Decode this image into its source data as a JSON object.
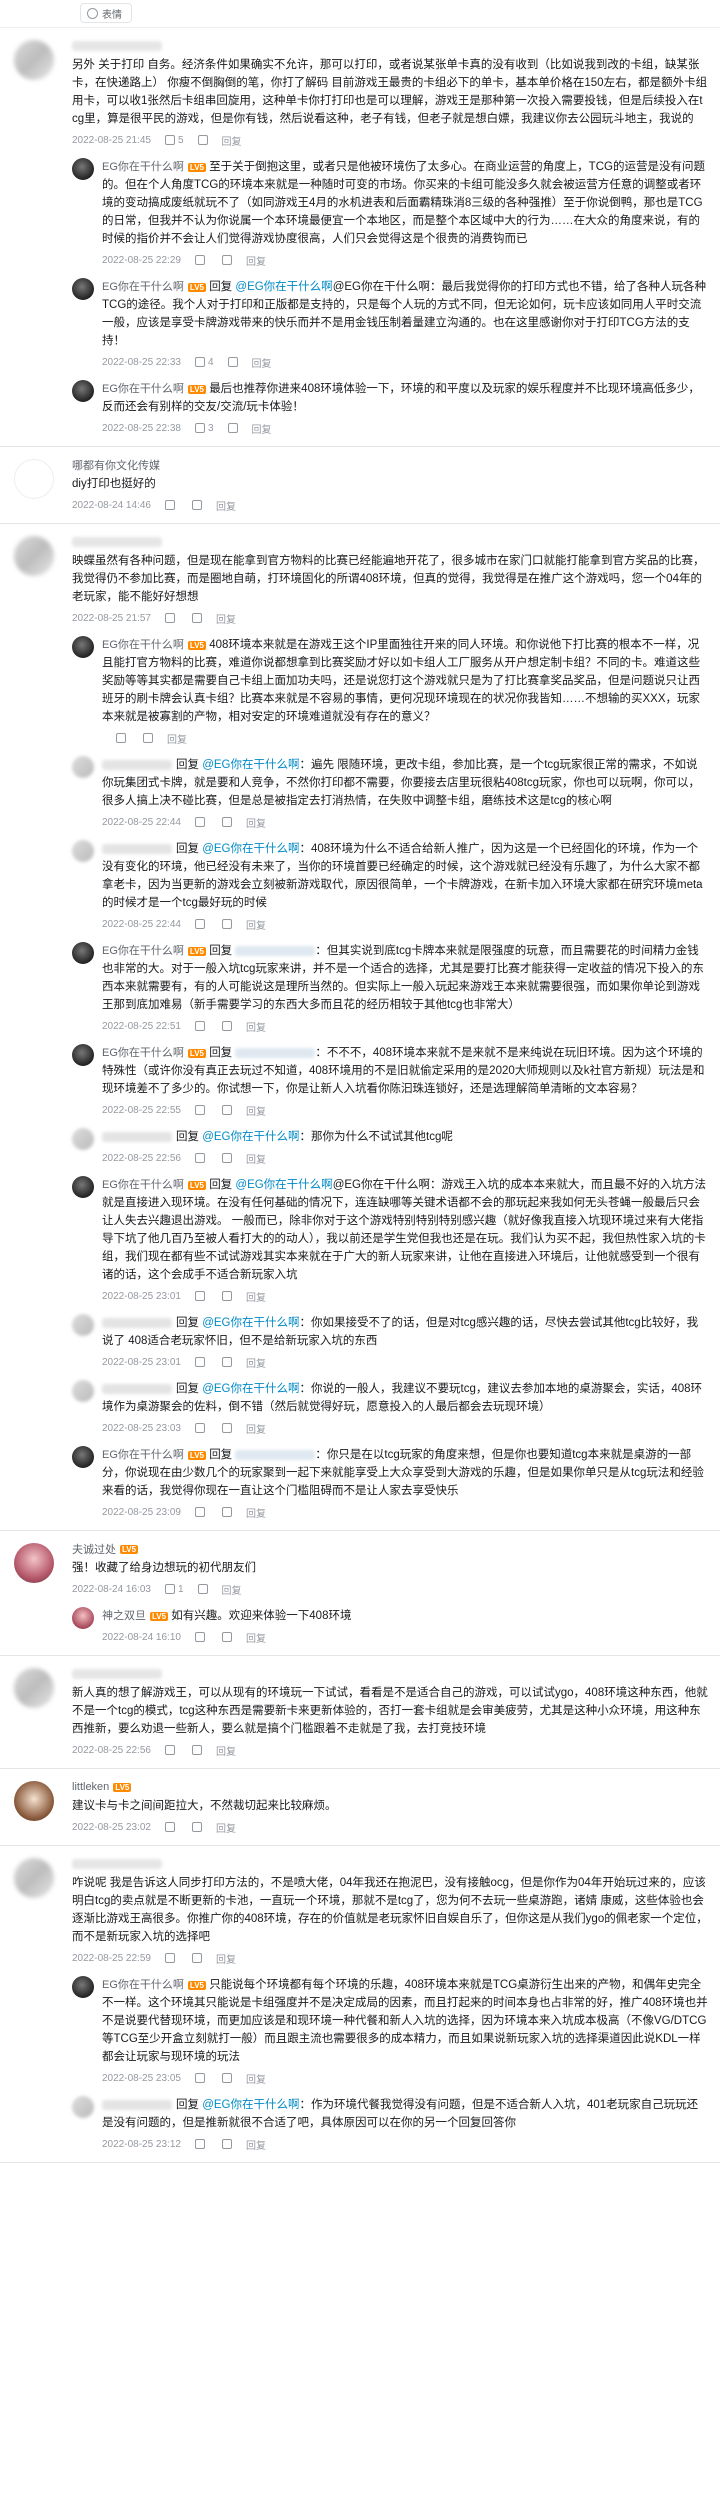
{
  "emoji_button": {
    "label": "表情",
    "icon": "smile-icon"
  },
  "reply_label": "回复",
  "comments": [
    {
      "username": "",
      "text": "另外 关于打印 自务。经济条件如果确实不允许，那可以打印，或者说某张单卡真的没有收到（比如说我到改的卡组，缺某张卡，在快递路上） 你瘦不倒胸倒的笔，你打了解码 目前游戏王最贵的卡组必下的单卡，基本单价格在150左右，都是额外卡组用卡，可以收1张然后卡组串回旋用，这种单卡你打打印也是可以理解，游戏王是那种第一次投入需要投钱，但是后续投入在tcg里，算是很平民的游戏，但是你有钱，然后说看这种，老子有钱，但老子就是想白嫖，我建议你去公园玩斗地主，我说的",
      "date": "2022-08-25 21:45",
      "likes": "5",
      "replies": [
        {
          "username": "EG你在干什么啊",
          "level": "LV5",
          "text": "至于关于倒抱这里，或者只是他被环境伤了太多心。在商业运营的角度上，TCG的运营是没有问题的。但在个人角度TCG的环境本来就是一种随时可变的市场。你买来的卡组可能没多久就会被运营方任意的调整或者环境的变动搞成废纸就玩不了（如同游戏王4月的水机进表和后面霸精珠消8三级的各种强推）至于你说倒鸭，那也是TCG的日常，但我并不认为你说属一个本环境最便宜一个本地区，而是整个本区域中大的行为……在大众的角度来说，有的时候的指价并不会让人们觉得游戏协度很高，人们只会觉得这是个很贵的消费钩而已",
          "date": "2022-08-25 22:29",
          "likes": "",
          "reply_prefix": "",
          "at": ""
        },
        {
          "username": "EG你在干什么啊",
          "level": "LV5",
          "text": "@EG你在干什么啊：最后我觉得你的打印方式也不错，给了各种人玩各种TCG的途径。我个人对于打印和正版都是支持的，只是每个人玩的方式不同，但无论如何，玩卡应该如同用人平时交流一般，应该是享受卡牌游戏带来的快乐而并不是用金钱压制着量建立沟通的。也在这里感谢你对于打印TCG方法的支持！",
          "date": "2022-08-25 22:33",
          "likes": "4",
          "reply_prefix": "回复",
          "at": "@EG你在干什么啊"
        },
        {
          "username": "EG你在干什么啊",
          "level": "LV5",
          "text": "最后也推荐你进来408环境体验一下，环境的和平度以及玩家的娱乐程度并不比现环境高低多少，反而还会有别样的交友/交流/玩卡体验！",
          "date": "2022-08-25 22:38",
          "likes": "3",
          "reply_prefix": "",
          "at": ""
        }
      ]
    },
    {
      "username": "哪都有你文化传媒",
      "text": "diy打印也挺好的",
      "date": "2022-08-24 14:46",
      "likes": "",
      "replies": []
    },
    {
      "username": "",
      "text": "映蝶虽然有各种问题，但是现在能拿到官方物料的比赛已经能遍地开花了，很多城市在家门口就能打能拿到官方奖品的比赛，我觉得仍不参加比赛，而是圈地自萌，打环境固化的所谓408环境，但真的觉得，我觉得是在推广这个游戏吗，您一个04年的老玩家，能不能好好想想",
      "date": "2022-08-25 21:57",
      "likes": "",
      "replies": [
        {
          "username": "EG你在干什么啊",
          "level": "LV5",
          "text": "408环境本来就是在游戏王这个IP里面独往开来的同人环境。和你说他下打比赛的根本不一样，况且能打官方物料的比赛，难道你说都想拿到比赛奖励才好以如卡组人工厂服务从开户想定制卡组？不同的卡。难道这些奖励等等其实都是需要自己卡组上面加功夫吗，还是说您打这个游戏就只是为了打比赛拿奖品奖品，但是问题说只让西班牙的刷卡牌会认真卡组？比赛本来就是不容易的事情，更何况现环境现在的状况你我皆知……不想输的买XXX，玩家本来就是被寡割的产物，相对安定的环境难道就没有存在的意义？",
          "date": "",
          "likes": "",
          "reply_prefix": "",
          "at": ""
        },
        {
          "username": "",
          "level": "",
          "text": "：遍先 限随环境，更改卡组，参加比赛，是一个tcg玩家很正常的需求，不如说你玩集团式卡牌，就是要和人竞争，不然你打印都不需要，你要接去店里玩很粘408tcg玩家，你也可以玩啊，你可以，很多人搞上决不碰比赛，但是总是被指定去打消热情，在失败中调整卡组，磨练技术这是tcg的核心啊",
          "date": "2022-08-25 22:44",
          "likes": "",
          "reply_prefix": "回复",
          "at": "@EG你在干什么啊"
        },
        {
          "username": "",
          "level": "",
          "text": "：408环境为什么不适合给新人推广，因为这是一个已经固化的环境，作为一个没有变化的环境，他已经没有未来了，当你的环境首要已经确定的时候，这个游戏就已经没有乐趣了，为什么大家不都拿老卡，因为当更新的游戏会立刻被新游戏取代，原因很简单，一个卡牌游戏，在新卡加入环境大家都在研究环境meta的时候才是一个tcg最好玩的时候",
          "date": "2022-08-25 22:44",
          "likes": "",
          "reply_prefix": "回复",
          "at": "@EG你在干什么啊"
        },
        {
          "username": "EG你在干什么啊",
          "level": "LV5",
          "text": "：但其实说到底tcg卡牌本来就是限强度的玩意，而且需要花的时间精力金钱也非常的大。对于一般入坑tcg玩家来讲，并不是一个适合的选择，尤其是要打比赛才能获得一定收益的情况下投入的东西本来就需要有，有的人可能说这是理所当然的。但实际上一般入玩起来游戏王本来就需要很强，而如果你单论到游戏王那到底加难易（新手需要学习的东西大多而且花的经历相较于其他tcg也非常大）",
          "date": "2022-08-25 22:51",
          "likes": "",
          "reply_prefix": "回复",
          "at": ""
        },
        {
          "username": "EG你在干什么啊",
          "level": "LV5",
          "text": "：不不不，408环境本来就不是来就不是来纯说在玩旧环境。因为这个环境的特殊性（或许你没有真正去玩过不知道，408环境用的不是旧就偷定采用的是2020大师规则以及k社官方新规）玩法是和现环境差不了多少的。你试想一下，你是让新人入坑看你陈汩珠连锁好，还是选理解简单清晰的文本容易？",
          "date": "2022-08-25 22:55",
          "likes": "",
          "reply_prefix": "回复",
          "at": ""
        },
        {
          "username": "",
          "level": "",
          "text": "：那你为什么不试试其他tcg呢",
          "date": "2022-08-25 22:56",
          "likes": "",
          "reply_prefix": "回复",
          "at": "@EG你在干什么啊"
        },
        {
          "username": "EG你在干什么啊",
          "level": "LV5",
          "text": "@EG你在干什么啊：游戏王入坑的成本本来就大，而且最不好的入坑方法就是直接进入现环境。在没有任何基础的情况下，连连缺哪等关键术语都不会的那玩起来我如何无头苍蝇一般最后只会让人失去兴趣退出游戏。    一般而已，除非你对于这个游戏特别特别特别感兴趣（就好像我直接入坑现环境过来有大佬指导下坑了他几百乃至被人看打大的的动人），我以前还是学生党但我也还是在玩。我们认为买不起，我但热性家入坑的卡组，我们现在都有些不试试游戏其实本来就在于广大的新人玩家来讲，让他在直接进入环境后，让他就感受到一个很有诸的话，这个会成手不适合新玩家入坑",
          "date": "2022-08-25 23:01",
          "likes": "",
          "reply_prefix": "回复",
          "at": "@EG你在干什么啊"
        },
        {
          "username": "",
          "level": "",
          "text": "：你如果接受不了的话，但是对tcg感兴趣的话，尽快去尝试其他tcg比较好，我说了 408适合老玩家怀旧，但不是给新玩家入坑的东西",
          "date": "2022-08-25 23:01",
          "likes": "",
          "reply_prefix": "回复",
          "at": "@EG你在干什么啊"
        },
        {
          "username": "",
          "level": "",
          "text": "：你说的一般人，我建议不要玩tcg，建议去参加本地的桌游聚会，实话，408环境作为桌游聚会的佐料，倒不错（然后就觉得好玩，愿意投入的人最后都会去玩现环境）",
          "date": "2022-08-25 23:03",
          "likes": "",
          "reply_prefix": "回复",
          "at": "@EG你在干什么啊"
        },
        {
          "username": "EG你在干什么啊",
          "level": "LV5",
          "text": "：你只是在以tcg玩家的角度来想，但是你也要知道tcg本来就是桌游的一部分，你说现在由少数几个的玩家聚到一起下来就能享受上大众享受到大游戏的乐趣，但是如果你单只是从tcg玩法和经验来看的话，我觉得你现在一直让这个门槛阻碍而不是让人家去享受快乐",
          "date": "2022-08-25 23:09",
          "likes": "",
          "reply_prefix": "回复",
          "at": ""
        }
      ]
    },
    {
      "username": "夫诚过处",
      "text": "强！收藏了给身边想玩的初代朋友们",
      "date": "2022-08-24 16:03",
      "likes": "1",
      "replies": [
        {
          "username": "神之双旦",
          "level": "LV5",
          "text": "如有兴趣。欢迎来体验一下408环境",
          "date": "2022-08-24 16:10",
          "likes": "",
          "reply_prefix": "",
          "at": ""
        }
      ]
    },
    {
      "username": "",
      "text": "新人真的想了解游戏王，可以从现有的环境玩一下试试，看看是不是适合自己的游戏，可以试试ygo，408环境这种东西，他就不是一个tcg的模式，tcg这种东西是需要新卡来更新体验的，否打一套卡组就是会审美疲劳，尤其是这种小众环境，用这种东西推新，要么劝退一些新人，要么就是搞个门槛跟着不走就是了我，去打竞技环境",
      "date": "2022-08-25 22:56",
      "likes": "",
      "replies": []
    },
    {
      "username": "littleken",
      "text": "建议卡与卡之间间距拉大，不然裁切起来比较麻烦。",
      "date": "2022-08-25 23:02",
      "likes": "",
      "replies": []
    },
    {
      "username": "",
      "text": "咋说呢 我是告诉这人同步打印方法的，不是喷大佬，04年我还在抱泥巴，没有接触ocg，但是你作为04年开始玩过来的，应该明白tcg的卖点就是不断更新的卡池，一直玩一个环境，那就不是tcg了，您为何不去玩一些桌游跑，诸婧 康威，这些体验也会逐渐比游戏王高很多。你推广你的408环境，存在的价值就是老玩家怀旧自娱自乐了，但你这是从我们ygo的佩老家一个定位，而不是新玩家入坑的选择吧",
      "date": "2022-08-25 22:59",
      "likes": "",
      "replies": [
        {
          "username": "EG你在干什么啊",
          "level": "LV5",
          "text": "只能说每个环境都有每个环境的乐趣，408环境本来就是TCG桌游衍生出来的产物，和偶年史完全不一样。这个环境其只能说是卡组强度并不是决定成局的因素，而且打起来的时间本身也占非常的好，推广408环境也并不是说要代替现环境，而更加应该是和现环境一种代餐和新人入坑的选择，因为环境本来入坑成本极高（不像VG/DTCG等TCG至少开盒立刻就打一般）而且跟主流也需要很多的成本精力，而且如果说新玩家入坑的选择渠道因此说KDL一样都会让玩家与现环境的玩法",
          "date": "2022-08-25 23:05",
          "likes": "",
          "reply_prefix": "",
          "at": ""
        },
        {
          "username": "",
          "level": "",
          "text": "：作为环境代餐我觉得没有问题，但是不适合新人入坑，401老玩家自己玩玩还是没有问题的，但是推新就很不合适了吧，具体原因可以在你的另一个回复回答你",
          "date": "2022-08-25 23:12",
          "likes": "",
          "reply_prefix": "回复",
          "at": "@EG你在干什么啊"
        }
      ]
    }
  ]
}
